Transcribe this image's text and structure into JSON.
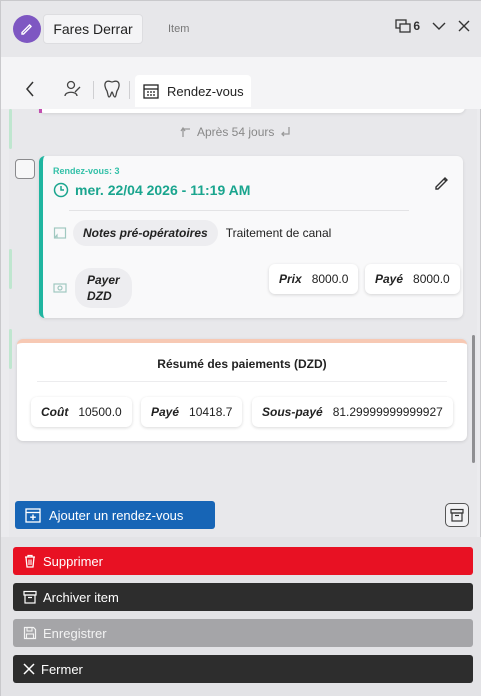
{
  "titlebar": {
    "patient_name": "Fares Derrar",
    "item_label": "Item",
    "window_count": "6"
  },
  "tabs": {
    "active_label": "Rendez-vous"
  },
  "timeline": {
    "after_label": "Après 54 jours"
  },
  "appointment": {
    "number_label": "Rendez-vous: 3",
    "datetime": "mer. 22/04 2026 - 11:19 AM",
    "notes_label": "Notes pré-opératoires",
    "notes_value": "Traitement de canal",
    "pay_label_line1": "Payer",
    "pay_label_line2": "DZD",
    "price_label": "Prix",
    "price_value": "8000.0",
    "paid_label": "Payé",
    "paid_value": "8000.0"
  },
  "summary": {
    "title": "Résumé des paiements (DZD)",
    "cost_label": "Coût",
    "cost_value": "10500.0",
    "paid_label": "Payé",
    "paid_value": "10418.7",
    "underpaid_label": "Sous-payé",
    "underpaid_value": "81.29999999999927"
  },
  "add_button_label": "Ajouter un rendez-vous",
  "actions": {
    "delete": "Supprimer",
    "archive": "Archiver item",
    "save": "Enregistrer",
    "close": "Fermer"
  },
  "colors": {
    "accent_teal": "#1fb5a0",
    "primary_blue": "#1765b6",
    "danger_red": "#e81123",
    "dark": "#2d2d2d",
    "app_badge_purple": "#7e57c2"
  }
}
